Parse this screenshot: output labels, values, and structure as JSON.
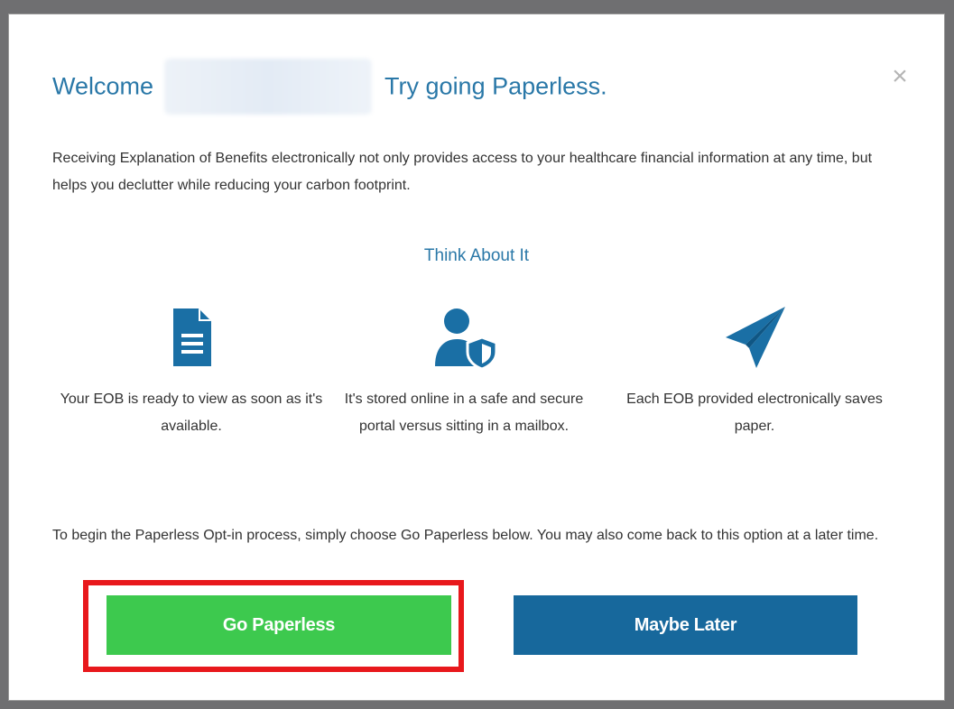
{
  "dialog": {
    "title_prefix": "Welcome",
    "title_suffix": "Try going Paperless.",
    "close_symbol": "×",
    "intro": "Receiving Explanation of Benefits electronically not only provides access to your healthcare financial information at any time, but helps you declutter while reducing your carbon footprint.",
    "subheading": "Think About It",
    "features": [
      {
        "icon": "document-icon",
        "text": "Your EOB is ready to view as soon as it's available."
      },
      {
        "icon": "user-shield-icon",
        "text": "It's stored online in a safe and secure portal versus sitting in a mailbox."
      },
      {
        "icon": "paper-plane-icon",
        "text": "Each EOB provided electronically saves paper."
      }
    ],
    "outro": "To begin the Paperless Opt-in process, simply choose Go Paperless below. You may also come back to this option at a later time.",
    "primary_button": "Go Paperless",
    "secondary_button": "Maybe Later"
  },
  "colors": {
    "accent_blue": "#2a78a8",
    "button_blue": "#17689c",
    "button_green": "#3dc94e",
    "highlight_red": "#e8181c"
  }
}
